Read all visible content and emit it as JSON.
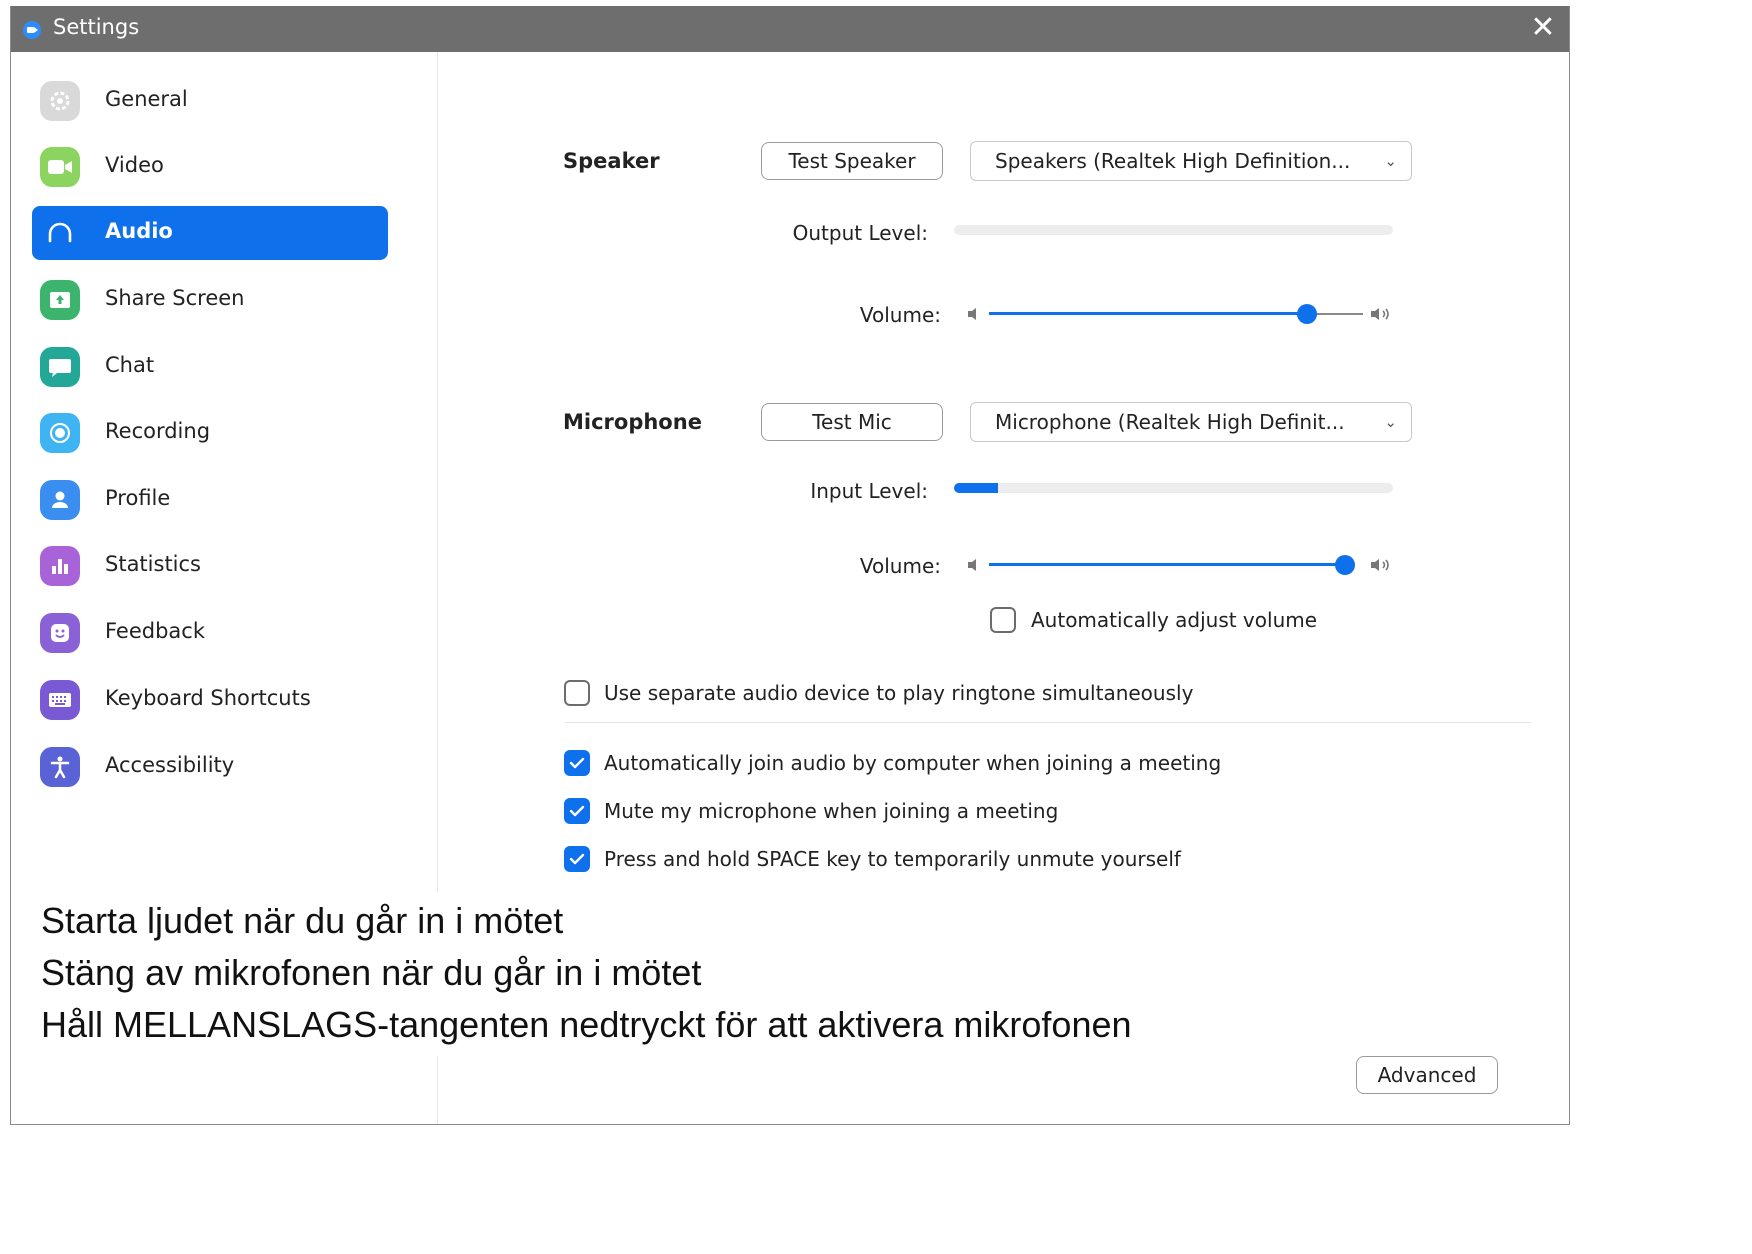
{
  "window": {
    "title": "Settings",
    "close_glyph": "✕"
  },
  "sidebar": {
    "items": [
      {
        "label": "General",
        "icon": "gear-icon",
        "color": "#d9d9d9",
        "active": false
      },
      {
        "label": "Video",
        "icon": "video-camera-icon",
        "color": "#8ad45f",
        "active": false
      },
      {
        "label": "Audio",
        "icon": "headphones-icon",
        "color": "#0e71eb",
        "active": true
      },
      {
        "label": "Share Screen",
        "icon": "share-screen-icon",
        "color": "#3cb46e",
        "active": false
      },
      {
        "label": "Chat",
        "icon": "chat-bubble-icon",
        "color": "#23a797",
        "active": false
      },
      {
        "label": "Recording",
        "icon": "record-icon",
        "color": "#3fb4f2",
        "active": false
      },
      {
        "label": "Profile",
        "icon": "profile-icon",
        "color": "#3a8ef0",
        "active": false
      },
      {
        "label": "Statistics",
        "icon": "statistics-icon",
        "color": "#a863d8",
        "active": false
      },
      {
        "label": "Feedback",
        "icon": "feedback-smiley-icon",
        "color": "#8a61d6",
        "active": false
      },
      {
        "label": "Keyboard Shortcuts",
        "icon": "keyboard-icon",
        "color": "#7a5ad4",
        "active": false
      },
      {
        "label": "Accessibility",
        "icon": "accessibility-icon",
        "color": "#5a63d6",
        "active": false
      }
    ]
  },
  "speaker": {
    "label": "Speaker",
    "test_button": "Test Speaker",
    "device": "Speakers (Realtek High Definition...",
    "output_level_label": "Output Level:",
    "output_level": 0,
    "volume_label": "Volume:",
    "volume": 0.85
  },
  "microphone": {
    "label": "Microphone",
    "test_button": "Test Mic",
    "device": "Microphone (Realtek High Definit...",
    "input_level_label": "Input Level:",
    "input_level": 0.1,
    "volume_label": "Volume:",
    "volume": 1.0,
    "auto_adjust_label": "Automatically adjust volume",
    "auto_adjust": false
  },
  "options": {
    "separate_ringtone": {
      "label": "Use separate audio device to play ringtone simultaneously",
      "checked": false
    },
    "auto_join_audio": {
      "label": "Automatically join audio by computer when joining a meeting",
      "checked": true
    },
    "mute_on_join": {
      "label": "Mute my microphone when joining a meeting",
      "checked": true
    },
    "space_unmute": {
      "label": "Press and hold SPACE key to temporarily unmute yourself",
      "checked": true
    }
  },
  "annotations": [
    "Starta ljudet  när du går in i mötet",
    "Stäng av mikrofonen när du går in i mötet",
    "Håll MELLANSLAGS-tangenten nedtryckt  för att aktivera mikrofonen"
  ],
  "advanced_button": "Advanced",
  "colors": {
    "accent": "#0e71eb",
    "titlebar": "#6e6e6e"
  }
}
